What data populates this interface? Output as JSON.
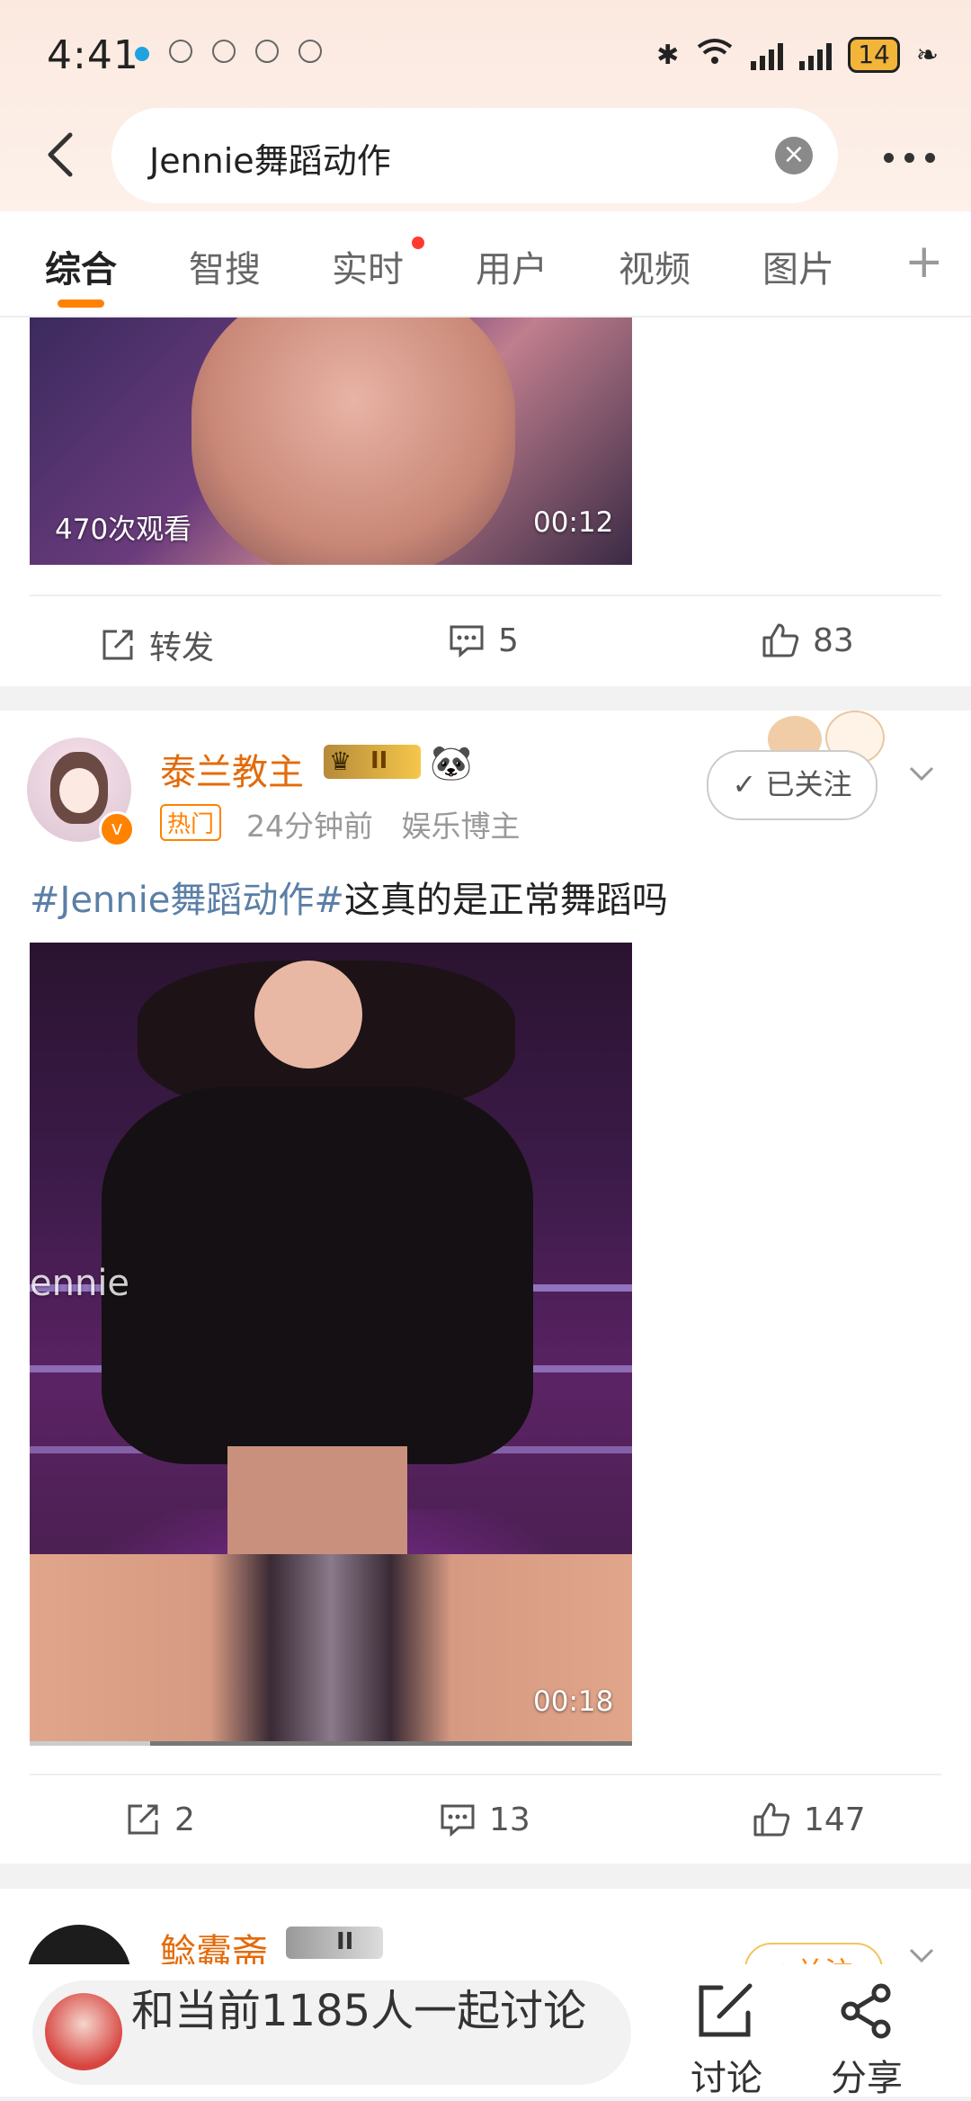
{
  "status_bar": {
    "time": "4:41",
    "battery": "14"
  },
  "search": {
    "query": "Jennie舞蹈动作"
  },
  "tabs": [
    {
      "label": "综合"
    },
    {
      "label": "智搜"
    },
    {
      "label": "实时"
    },
    {
      "label": "用户"
    },
    {
      "label": "视频"
    },
    {
      "label": "图片"
    }
  ],
  "post1": {
    "video_views": "470次观看",
    "video_duration": "00:12",
    "repost_label": "转发",
    "comments": "5",
    "likes": "83"
  },
  "post2": {
    "username": "泰兰教主",
    "level": "II",
    "hot_tag": "热门",
    "time_ago": "24分钟前",
    "role": "娱乐博主",
    "follow_label": "已关注",
    "hashtag": "#Jennie舞蹈动作#",
    "text": "这真的是正常舞蹈吗",
    "video_watermark": "ennie",
    "video_duration": "00:18",
    "reposts": "2",
    "comments": "13",
    "likes": "147"
  },
  "post3": {
    "username": "鲶蠹斋",
    "level": "II",
    "follow_label": "+关注"
  },
  "bottom_bar": {
    "discussion_text": "和当前1185人一起讨论",
    "discuss_label": "讨论",
    "share_label": "分享"
  },
  "colors": {
    "accent": "#ff8200",
    "username": "#e36b0b",
    "hashtag": "#5b7fa6",
    "notification": "#ff3b30"
  }
}
